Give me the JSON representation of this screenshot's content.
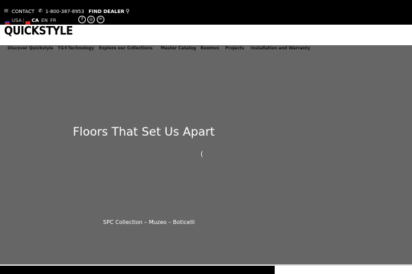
{
  "topbar": {
    "contact": "CONTACT",
    "phone": "1-800-387-8953",
    "find_dealer": "FIND DEALER",
    "country_usa": "USA",
    "country_ca": "CA",
    "lang_en": "EN",
    "lang_fr": "FR",
    "divider": "|"
  },
  "social": {
    "facebook": "f",
    "instagram": "◎",
    "linkedin": "in"
  },
  "logo": "QUICKSTYLE",
  "nav": [
    "Discover Quickstyle",
    "TG®Technology",
    "Explore our Collections",
    "Master Catalog",
    "Roomvo",
    "Projects",
    "Installation and Warranty"
  ],
  "hero": {
    "title": "Floors That Set Us Apart",
    "paren": "(",
    "caption": "SPC Collection – Muzeo – Boticelli"
  }
}
